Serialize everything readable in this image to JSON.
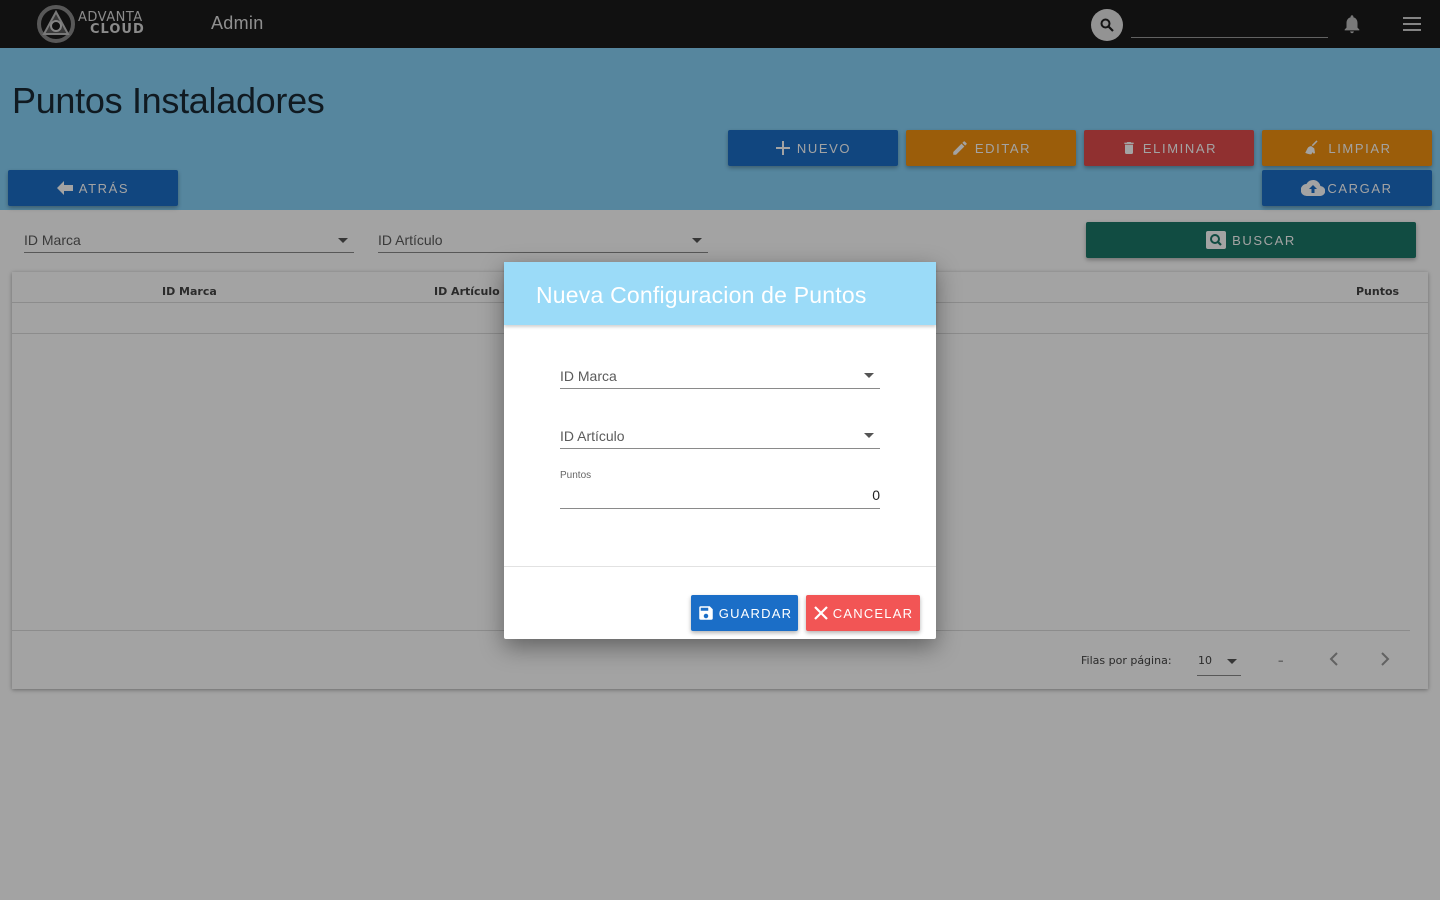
{
  "topbar": {
    "logo_line1": "ADVANTA",
    "logo_line2": "CLOUD",
    "app_title": "Admin",
    "search_value": ""
  },
  "page": {
    "title": "Puntos Instaladores",
    "buttons": {
      "nuevo": "NUEVO",
      "editar": "EDITAR",
      "eliminar": "ELIMINAR",
      "limpiar": "LIMPIAR",
      "atras": "ATRÁS",
      "cargar": "CARGAR",
      "buscar": "BUSCAR"
    },
    "filters": {
      "marca": "ID Marca",
      "articulo": "ID Artículo"
    }
  },
  "table": {
    "columns": [
      "ID Marca",
      "ID Artículo",
      "Puntos"
    ],
    "rows_per_page_label": "Filas por página:",
    "rows_per_page_value": "10",
    "range_text": "–"
  },
  "dialog": {
    "title": "Nueva Configuracion de Puntos",
    "field_marca": "ID Marca",
    "field_articulo": "ID Artículo",
    "puntos_label": "Puntos",
    "puntos_value": "0",
    "save_label": "GUARDAR",
    "cancel_label": "CANCELAR"
  },
  "colors": {
    "topbar": "#1c1c1c",
    "header": "#87d2f8",
    "blue": "#1b6ec7",
    "orange": "#f29210",
    "red": "#e14b4b",
    "green": "#1c7768",
    "dialog_header": "#9bdbf8"
  }
}
